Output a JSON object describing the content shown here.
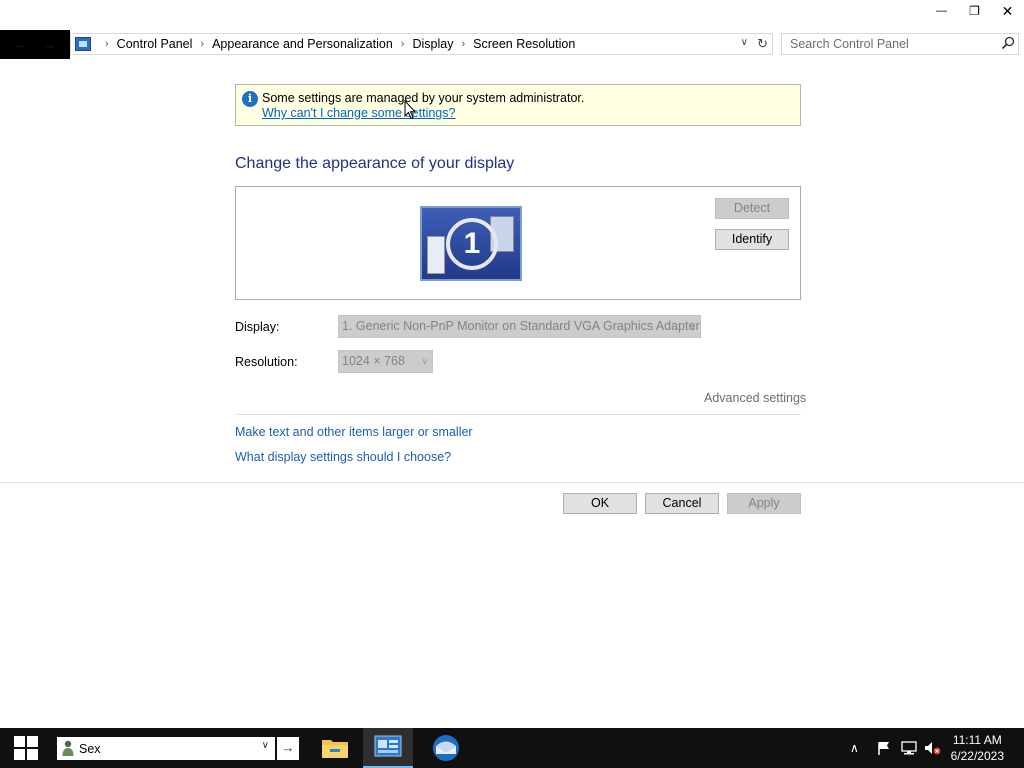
{
  "window": {
    "minimize": "—",
    "restore": "❐",
    "close": "✕"
  },
  "address_bar": {
    "crumbs": [
      "Control Panel",
      "Appearance and Personalization",
      "Display",
      "Screen Resolution"
    ],
    "separator": "›",
    "dropdown": "∨",
    "refresh": "↻"
  },
  "search": {
    "placeholder": "Search Control Panel"
  },
  "info_banner": {
    "message": "Some settings are managed by your system administrator.",
    "link": "Why can't I change some settings?"
  },
  "main": {
    "heading": "Change the appearance of your display",
    "monitor_number": "1",
    "detect_label": "Detect",
    "identify_label": "Identify",
    "display_label": "Display:",
    "display_value": "1. Generic Non-PnP Monitor on Standard VGA Graphics Adapter",
    "resolution_label": "Resolution:",
    "resolution_value": "1024 × 768",
    "advanced_settings": "Advanced settings",
    "link_text_size": "Make text and other items larger or smaller",
    "link_which_settings": "What display settings should I choose?"
  },
  "buttons": {
    "ok": "OK",
    "cancel": "Cancel",
    "apply": "Apply"
  },
  "taskbar": {
    "search_value": "Sex",
    "go": "→",
    "tray_chevron": "∧",
    "time": "11:11 AM",
    "date": "6/22/2023"
  },
  "colors": {
    "accent": "#0078d7",
    "link": "#1a5fb4",
    "heading": "#1e3287",
    "banner": "#ffffe1",
    "taskbar": "#101010"
  }
}
